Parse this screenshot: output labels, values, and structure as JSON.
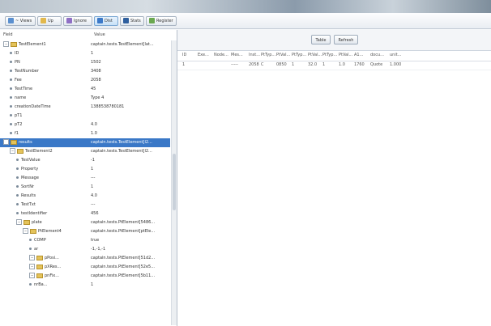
{
  "toolbar": {
    "buttons": [
      {
        "label": "~ Views",
        "icon": "views-icon",
        "color": "#5a8fcf",
        "active": false
      },
      {
        "label": "Up",
        "icon": "folder-up-icon",
        "color": "#e2b84c",
        "active": false
      },
      {
        "label": "Ignore",
        "icon": "ignore-icon",
        "color": "#8f6fc5",
        "active": false
      },
      {
        "label": "Dist",
        "icon": "dist-icon",
        "color": "#3c79c8",
        "active": true
      },
      {
        "label": "Stats",
        "icon": "stats-icon",
        "color": "#2f5f9e",
        "active": false
      },
      {
        "label": "Register",
        "icon": "register-icon",
        "color": "#6aa84f",
        "active": false
      }
    ]
  },
  "tree": {
    "col_field": "Field",
    "col_value": "Value",
    "rows": [
      {
        "key": "TestElement1",
        "value": "captain.tests.TestElement[lat...",
        "indent": 0,
        "kind": "folder"
      },
      {
        "key": "ID",
        "value": "1",
        "indent": 1,
        "kind": "leaf"
      },
      {
        "key": "PN",
        "value": "1502",
        "indent": 1,
        "kind": "leaf"
      },
      {
        "key": "TestNumber",
        "value": "3408",
        "indent": 1,
        "kind": "leaf"
      },
      {
        "key": "Fee",
        "value": "2058",
        "indent": 1,
        "kind": "leaf"
      },
      {
        "key": "TestTime",
        "value": "45",
        "indent": 1,
        "kind": "leaf"
      },
      {
        "key": "name",
        "value": "Type 4",
        "indent": 1,
        "kind": "leaf"
      },
      {
        "key": "creationDateTime",
        "value": "1388538780181",
        "indent": 1,
        "kind": "leaf"
      },
      {
        "key": "pT1",
        "value": "",
        "indent": 1,
        "kind": "leaf"
      },
      {
        "key": "pT2",
        "value": "4.0",
        "indent": 1,
        "kind": "leaf"
      },
      {
        "key": "f1",
        "value": "1.0",
        "indent": 1,
        "kind": "leaf"
      },
      {
        "key": "results",
        "value": "captain.tests.TestElement[l2...",
        "indent": 0,
        "kind": "folder",
        "selected": true
      },
      {
        "key": "TestElement2",
        "value": "captain.tests.TestElement[l2...",
        "indent": 1,
        "kind": "folder"
      },
      {
        "key": "TestValue",
        "value": "-1",
        "indent": 2,
        "kind": "leaf"
      },
      {
        "key": "Property",
        "value": "1",
        "indent": 2,
        "kind": "leaf"
      },
      {
        "key": "Message",
        "value": "---",
        "indent": 2,
        "kind": "leaf"
      },
      {
        "key": "SortNr",
        "value": "1",
        "indent": 2,
        "kind": "leaf"
      },
      {
        "key": "Results",
        "value": "4.0",
        "indent": 2,
        "kind": "leaf"
      },
      {
        "key": "TestTxt",
        "value": "---",
        "indent": 2,
        "kind": "leaf"
      },
      {
        "key": "testIdentifier",
        "value": "456",
        "indent": 2,
        "kind": "leaf"
      },
      {
        "key": "plate",
        "value": "captain.tests.PtElement[5486...",
        "indent": 2,
        "kind": "folder"
      },
      {
        "key": "PtElement4",
        "value": "captain.tests.PtElement[ptEle...",
        "indent": 3,
        "kind": "folder"
      },
      {
        "key": "COMP",
        "value": "true",
        "indent": 4,
        "kind": "leaf"
      },
      {
        "key": "ar",
        "value": "-1,-1,-1",
        "indent": 4,
        "kind": "leaf"
      },
      {
        "key": "pPosi...",
        "value": "captain.tests.PtElement[51d2...",
        "indent": 4,
        "kind": "folder"
      },
      {
        "key": "pXRes...",
        "value": "captain.tests.PtElement[52e5...",
        "indent": 4,
        "kind": "folder"
      },
      {
        "key": "pnFix...",
        "value": "captain.tests.PtElement[5b11...",
        "indent": 4,
        "kind": "folder"
      },
      {
        "key": "nrBa...",
        "value": "1",
        "indent": 4,
        "kind": "leaf"
      }
    ]
  },
  "right": {
    "buttons": [
      "Table",
      "Refresh"
    ],
    "columns": [
      "ID",
      "Exe...",
      "Node...",
      "Mes...",
      "Inst...",
      "PtTyp...",
      "PtVal...",
      "PtTyp...",
      "PtVal...",
      "PtTyp...",
      "PtVal...",
      "A1...",
      "docu...",
      "unit..."
    ],
    "rows": [
      [
        "1",
        "",
        "",
        "-----",
        "2058",
        "C",
        "0850",
        "1",
        "32.0",
        "1",
        "1.0",
        "1760",
        "Quote",
        "1.000"
      ]
    ]
  }
}
